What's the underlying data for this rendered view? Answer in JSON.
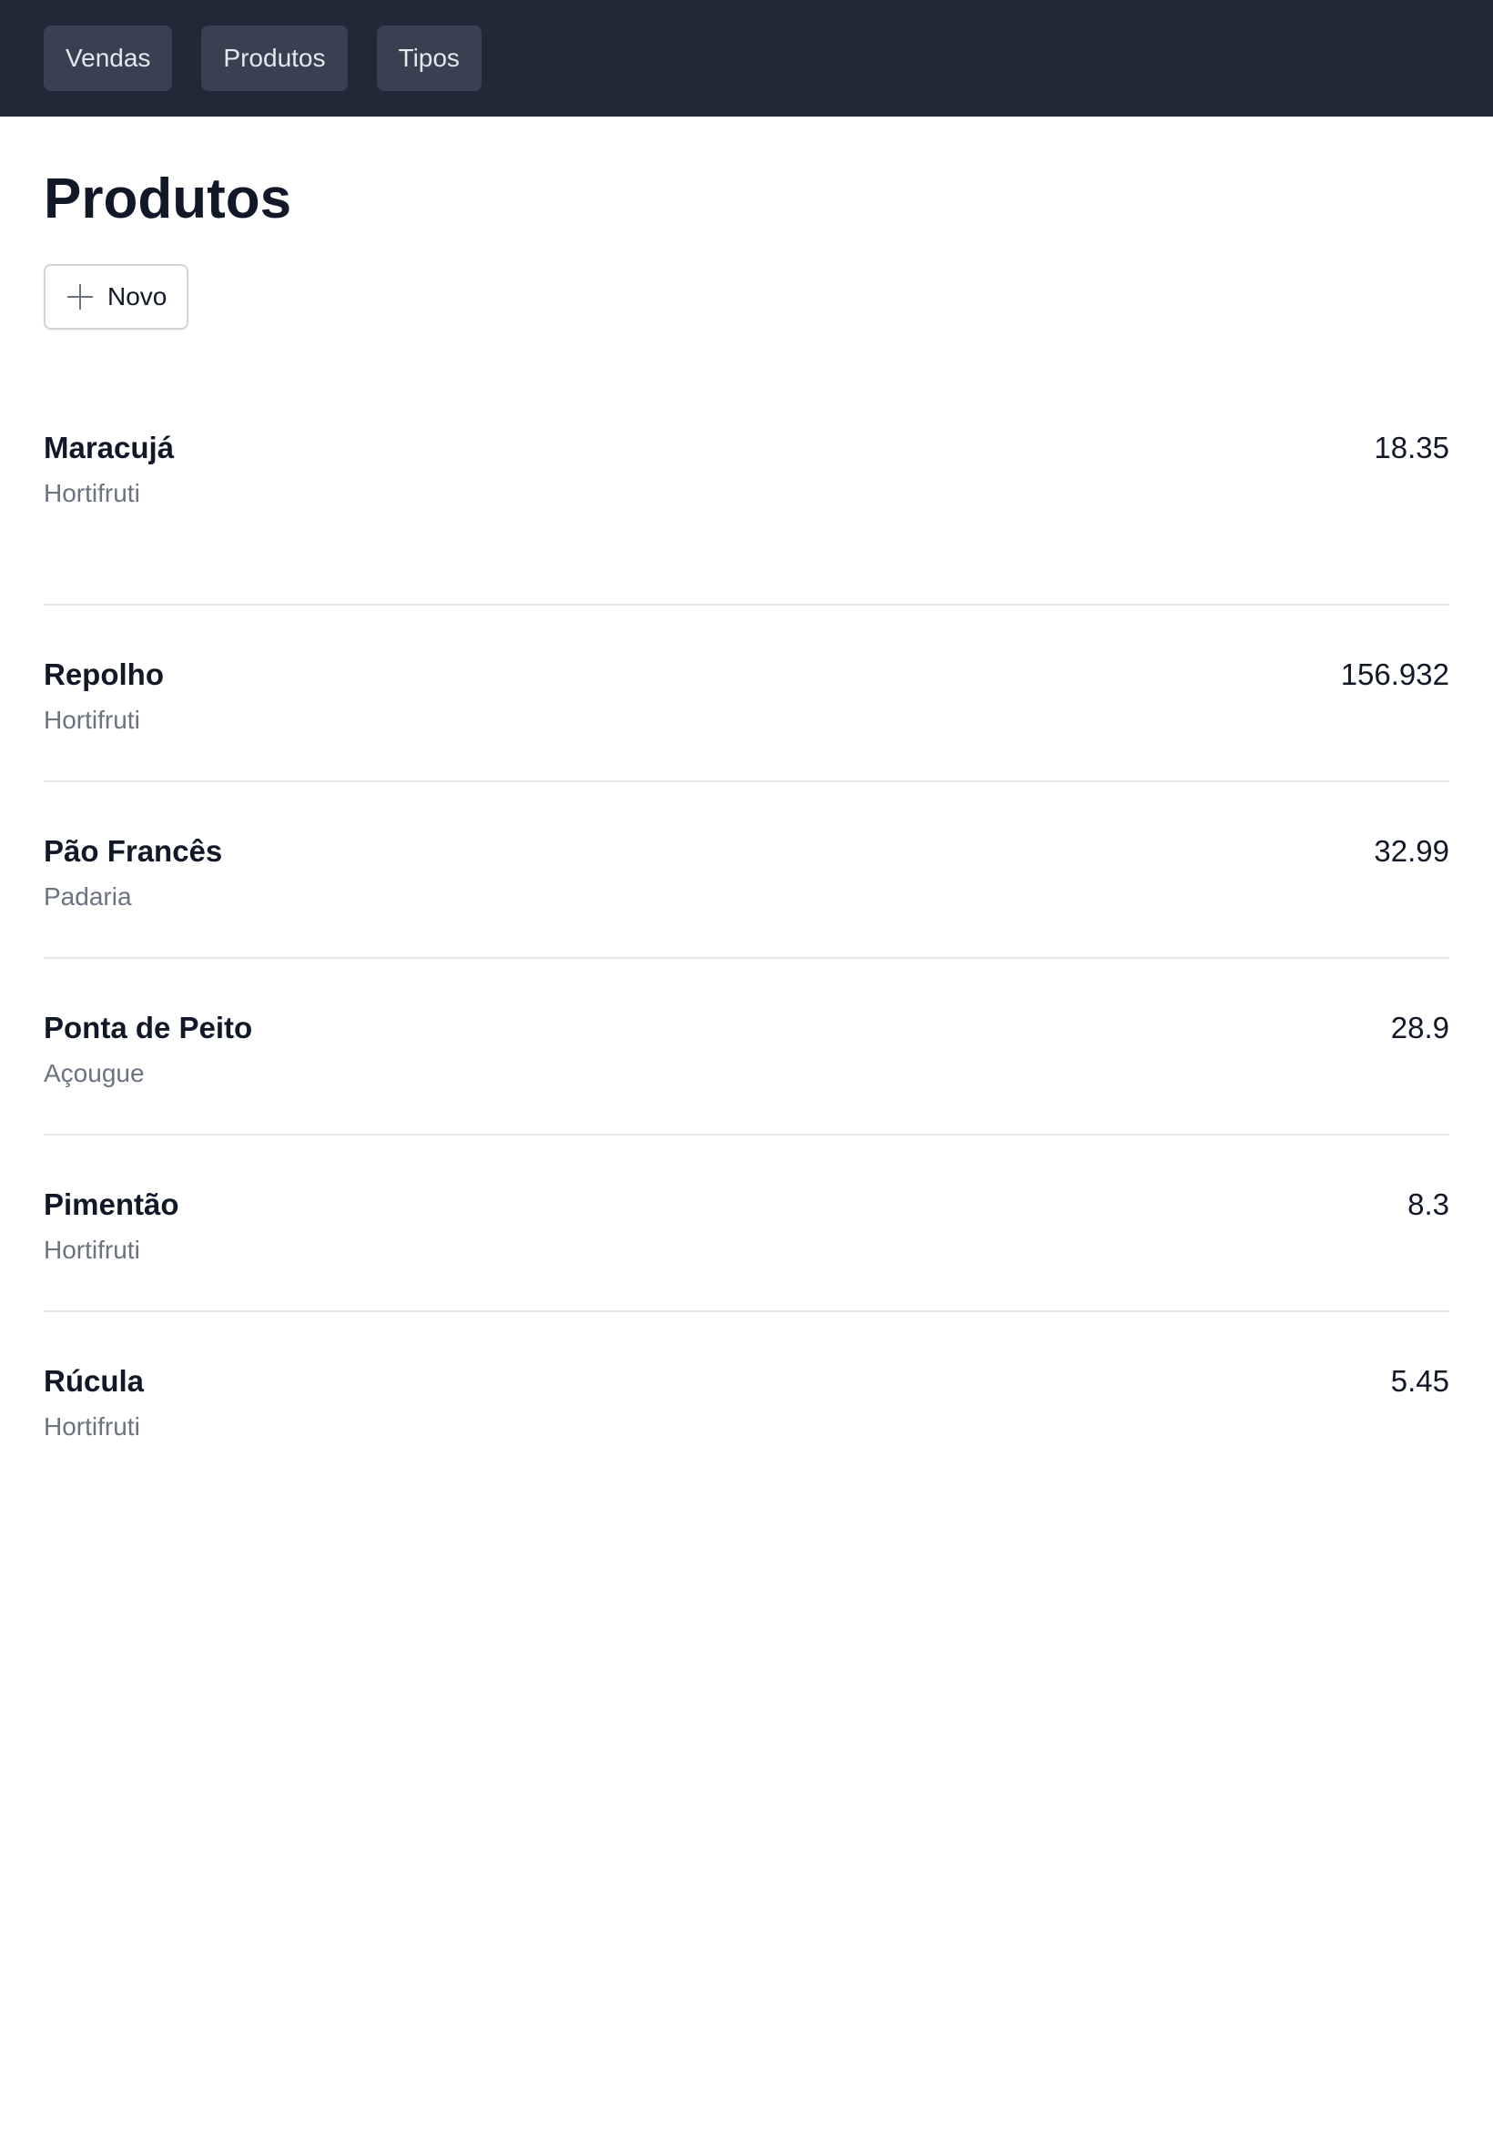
{
  "nav": {
    "items": [
      {
        "label": "Vendas"
      },
      {
        "label": "Produtos"
      },
      {
        "label": "Tipos"
      }
    ]
  },
  "page": {
    "title": "Produtos",
    "new_button_label": "Novo"
  },
  "products": [
    {
      "name": "Maracujá",
      "type": "Hortifruti",
      "price": "18.35"
    },
    {
      "name": "Repolho",
      "type": "Hortifruti",
      "price": "156.932"
    },
    {
      "name": "Pão Francês",
      "type": "Padaria",
      "price": "32.99"
    },
    {
      "name": "Ponta de Peito",
      "type": "Açougue",
      "price": "28.9"
    },
    {
      "name": "Pimentão",
      "type": "Hortifruti",
      "price": "8.3"
    },
    {
      "name": "Rúcula",
      "type": "Hortifruti",
      "price": "5.45"
    }
  ],
  "colors": {
    "topbar": "#1f2937",
    "nav_button": "#374151",
    "text_primary": "#111827",
    "text_secondary": "#6b7280",
    "divider": "#e5e7eb"
  }
}
